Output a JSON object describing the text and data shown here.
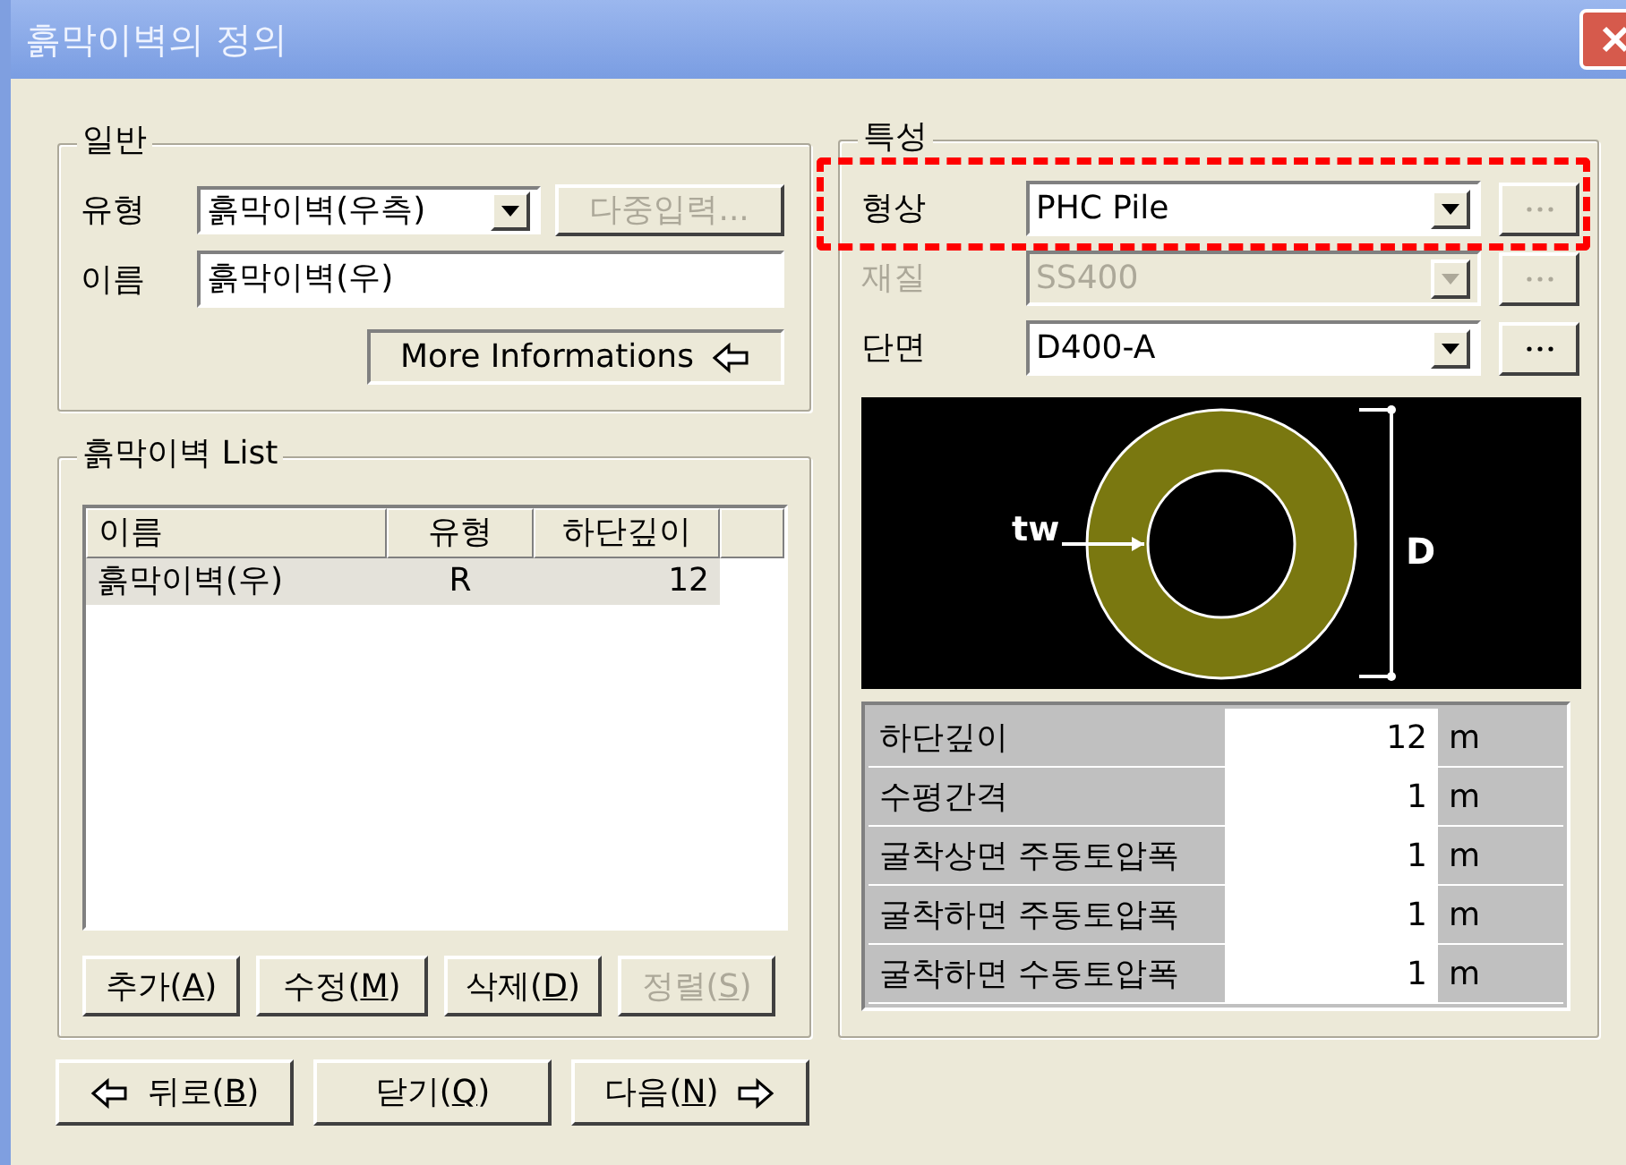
{
  "window": {
    "title": "흙막이벽의 정의"
  },
  "general": {
    "legend": "일반",
    "type_label": "유형",
    "type_value": "흙막이벽(우측)",
    "multi_button": {
      "label": "다중입력...",
      "disabled": true
    },
    "name_label": "이름",
    "name_value": "흙막이벽(우)",
    "more_button": "More Informations"
  },
  "wall_list": {
    "legend": "흙막이벽 List",
    "columns": [
      "이름",
      "유형",
      "하단깊이"
    ],
    "rows": [
      {
        "cells": [
          "흙막이벽(우)",
          "R",
          "12"
        ],
        "selected": true
      }
    ],
    "buttons": [
      {
        "parts": [
          "추가(",
          "A",
          ")"
        ],
        "disabled": false
      },
      {
        "parts": [
          "수정(",
          "M",
          ")"
        ],
        "disabled": false
      },
      {
        "parts": [
          "삭제(",
          "D",
          ")"
        ],
        "disabled": false
      },
      {
        "parts": [
          "정렬(",
          "S",
          ")"
        ],
        "disabled": true
      }
    ]
  },
  "nav_buttons": [
    {
      "parts": [
        "뒤로(",
        "B",
        ")"
      ],
      "kind": "back"
    },
    {
      "parts": [
        "닫기(",
        "Q",
        ")"
      ],
      "kind": "plain"
    },
    {
      "parts": [
        "다음(",
        "N",
        ")"
      ],
      "kind": "next"
    }
  ],
  "properties": {
    "legend": "특성",
    "fields": [
      {
        "label": "형상",
        "value": "PHC Pile",
        "disabled": false,
        "highlighted": true
      },
      {
        "label": "재질",
        "value": "SS400",
        "disabled": true,
        "highlighted": false
      },
      {
        "label": "단면",
        "value": "D400-A",
        "disabled": false,
        "highlighted": false
      }
    ],
    "section_labels": {
      "thickness": "tw",
      "diameter": "D"
    },
    "grid": [
      {
        "label": "하단깊이",
        "value": "12",
        "unit": "m"
      },
      {
        "label": "수평간격",
        "value": "1",
        "unit": "m"
      },
      {
        "label": "굴착상면 주동토압폭",
        "value": "1",
        "unit": "m"
      },
      {
        "label": "굴착하면 주동토압폭",
        "value": "1",
        "unit": "m"
      },
      {
        "label": "굴착하면 수동토압폭",
        "value": "1",
        "unit": "m"
      }
    ]
  }
}
